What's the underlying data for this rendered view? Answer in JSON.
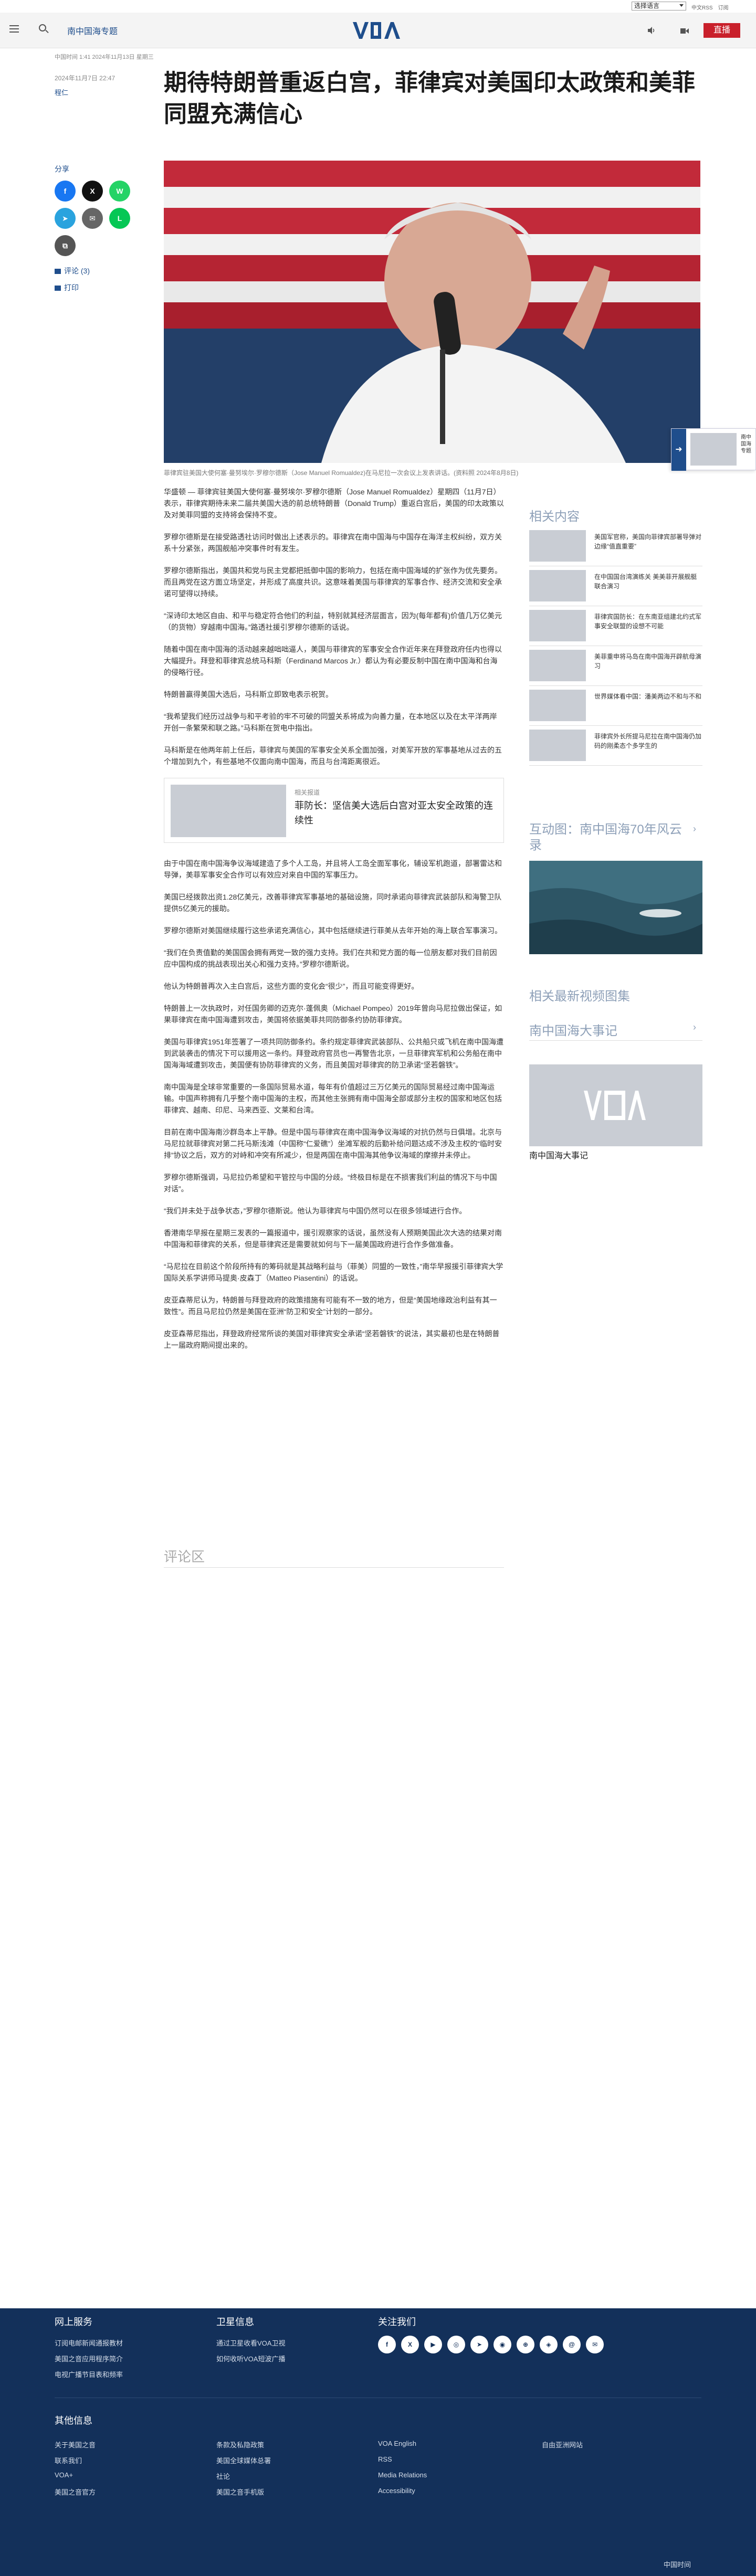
{
  "topbar": {
    "language": "选择语言",
    "links": [
      "中文RSS",
      "订阅"
    ]
  },
  "header": {
    "section": "南中国海专题",
    "logo": "VOA",
    "live": "直播"
  },
  "byline": {
    "date_line": "中国时间 1:41 2024年11月13日 星期三",
    "date": "2024年11月7日 22:47",
    "author": "程仁"
  },
  "headline": "期待特朗普重返白宫，菲律宾对美国印太政策和美菲同盟充满信心",
  "share": {
    "label": "分享",
    "buttons": [
      {
        "icon": "facebook-icon",
        "glyph": "f",
        "color": "#1877f2"
      },
      {
        "icon": "x-icon",
        "glyph": "X",
        "color": "#111111"
      },
      {
        "icon": "whatsapp-icon",
        "glyph": "W",
        "color": "#25d366"
      },
      {
        "icon": "telegram-icon",
        "glyph": "➤",
        "color": "#2aa3de"
      },
      {
        "icon": "email-icon",
        "glyph": "✉",
        "color": "#666666"
      },
      {
        "icon": "line-icon",
        "glyph": "L",
        "color": "#06c755"
      },
      {
        "icon": "copy-link-icon",
        "glyph": "⧉",
        "color": "#555555"
      }
    ],
    "comment": "评论 (3)",
    "print": "打印"
  },
  "hero": {
    "caption": "菲律宾驻美国大使何塞·曼努埃尔·罗穆尔德斯（Jose Manuel Romualdez)在马尼拉一次会议上发表讲话。(资料照 2024年8月8日)"
  },
  "float_tab": {
    "text": "南中国海专题"
  },
  "article": {
    "paragraphs": [
      "华盛顿 — 菲律宾驻美国大使何塞·曼努埃尔·罗穆尔德斯（Jose Manuel Romualdez）星期四（11月7日）表示，菲律宾期待未来二届共美国大选的前总统特朗普（Donald Trump）重返白宫后，美国的印太政策以及对美菲同盟的支持将会保持不变。",
      "罗穆尔德斯是在接受路透社访问时做出上述表示的。菲律宾在南中国海与中国存在海洋主权纠纷，双方关系十分紧张，两国舰船冲突事件时有发生。",
      "罗穆尔德斯指出，美国共和党与民主党都把抵御中国的影响力，包括在南中国海域的扩张作为优先要务。而且两党在这方面立场坚定，并形成了高度共识。这意味着美国与菲律宾的军事合作、经济交流和安全承诺可望得以持续。",
      "“深诗印太地区自由、和平与稳定符合他们的利益，特别就其经济层面言，因为(每年都有)价值几万亿美元（的货物）穿越南中国海。”路透社援引罗穆尔德斯的话说。",
      "随着中国在南中国海的活动越来越咄咄逼人，美国与菲律宾的军事安全合作近年来在拜登政府任内也得以大幅提升。拜登和菲律宾总统马科斯（Ferdinand Marcos Jr.）都认为有必要反制中国在南中国海和台海的侵略行径。",
      "特朗普赢得美国大选后，马科斯立即致电表示祝贺。",
      "“我希望我们经历过战争与和平考验的牢不可破的同盟关系将成为向善力量，在本地区以及在太平洋两岸开创一条繁荣和联之路。”马科斯在贺电中指出。",
      "马科斯是在他两年前上任后，菲律宾与美国的军事安全关系全面加强，对美军开放的军事基地从过去的五个增加到九个，有些基地不仅面向南中国海，而且与台湾距离很近。",
      "由于中国在南中国海争议海域建造了多个人工岛，并且将人工岛全面军事化，辅设军机跑道，部署雷达和导弹，美菲军事安全合作可以有效应对来自中国的军事压力。",
      "美国已经拨款出资1.28亿美元，改善菲律宾军事基地的基础设施，同时承诺向菲律宾武装部队和海警卫队提供5亿美元的援助。",
      "罗穆尔德斯对美国继续履行这些承诺充满信心，其中包括继续进行菲美从去年开始的海上联合军事演习。",
      "“我们在负责值勤的美国国会拥有两党一致的强力支持。我们在共和党方面的每一位朋友都对我们目前因应中国构成的挑战表现出关心和强力支持。”罗穆尔德斯说。",
      "他认为特朗普再次入主白宫后，这些方面的变化会“很少”，而且可能变得更好。",
      "特朗普上一次执政时，对任国务卿的迈克尔·蓬佩奥（Michael Pompeo）2019年曾向马尼拉做出保证，如果菲律宾在南中国海遭到攻击，美国将依据美菲共同防御条约协防菲律宾。",
      "美国与菲律宾1951年签署了一项共同防御条约。条约规定菲律宾武装部队、公共船只或飞机在南中国海遭到武装袭击的情况下可以援用这一条约。拜登政府官员也一再警告北京，一旦菲律宾军机和公务船在南中国海海域遭到攻击，美国便有协防菲律宾的义务，而且美国对菲律宾的防卫承诺“坚若磐铁”。",
      "南中国海是全球非常重要的一条国际贸易水道，每年有价值超过三万亿美元的国际贸易经过南中国海运输。中国声称拥有几乎整个南中国海的主权，而其他主张拥有南中国海全部或部分主权的国家和地区包括菲律宾、越南、印尼、马来西亚、文莱和台湾。",
      "目前在南中国海南沙群岛本上平静。但是中国与菲律宾在南中国海争议海域的对抗仍然与日俱增。北京与马尼拉就菲律宾对第二托马斯浅滩（中国称“仁爱礁”）坐滩军舰的后勤补给问题达成不涉及主权的“临时安排”协议之后，双方的对峙和冲突有所减少，但是两国在南中国海其他争议海域的摩擦并未停止。",
      "罗穆尔德斯强调，马尼拉仍希望和平管控与中国的分歧。“终极目标是在不损害我们利益的情况下与中国对话”。",
      "“我们并未处于战争状态，”罗穆尔德斯说。他认为菲律宾与中国仍然可以在很多领域进行合作。",
      "香港南华早报在星期三发表的一篇报道中，援引观察家的话说，虽然没有人预期美国此次大选的结果对南中国海和菲律宾的关系，但是菲律宾还是需要就如何与下一届美国政府进行合作多做准备。",
      "“马尼拉在目前这个阶段所持有的筹码就是其战略利益与（菲美）同盟的一致性，”南华早报援引菲律宾大学国际关系学讲师马提奥·皮森丁（Matteo Piasentini）的话说。",
      "皮亚森蒂尼认为，特朗普与拜登政府的政策措施有可能有不一致的地方，但是“美国地缘政治利益有其一致性”。而且马尼拉仍然是美国在亚洲“防卫和安全”计划的一部分。",
      "皮亚森蒂尼指出，拜登政府经常所谈的美国对菲律宾安全承诺“坚若磐铁”的说法，其实最初也是在特朗普上一届政府期间提出来的。"
    ],
    "related": {
      "sub": "相关报道",
      "title": "菲防长：坚信美大选后白宫对亚太安全政策的连续性"
    },
    "comments": "评论区"
  },
  "sidebar": {
    "related_head": "相关内容",
    "related_items": [
      "美国军官称，美国向菲律宾部署导弹对边缘“值直重要”",
      "在中国国台湾演练关 美美菲开展舰艇联合演习",
      "菲律宾国防长：在东南亚组建北约式军事安全联盟的设想不可能",
      "美菲重申将马岛在南中国海开辟航母演习",
      "世界媒体看中国：潘美两边不和与不和",
      "菲律宾外长所提马尼拉在南中国海仍加码的刚柔态个多学生的"
    ],
    "video_head": "互动图：南中国海70年风云录",
    "recent_video_head": "相关最新视频图集",
    "events_head": "南中国海大事记",
    "events_caption": "南中国海大事记"
  },
  "footer": {
    "sections": [
      {
        "title": "网上服务",
        "links": [
          "订阅电邮新闻通报教材",
          "美国之音应用程序简介",
          "电视广播节目表和频率"
        ]
      },
      {
        "title": "卫星信息",
        "links": [
          "通过卫星收看VOA卫视",
          "如何收听VOA短波广播"
        ]
      },
      {
        "title": "关注我们",
        "links": []
      }
    ],
    "social": [
      "f",
      "X",
      "▶",
      "◎",
      "➤",
      "◉",
      "⊕",
      "◈",
      "@",
      "✉"
    ],
    "other_head": "其他信息",
    "other_links": [
      [
        "关于美国之音",
        "联系我们",
        "VOA+",
        "美国之音官方"
      ],
      [
        "条款及私隐政策",
        "美国全球媒体总署",
        "社论",
        "美国之音手机版"
      ],
      [
        "VOA English",
        "RSS",
        "Media Relations",
        "Accessibility"
      ],
      [
        "自由亚洲网站"
      ]
    ],
    "copyright": "中国时间"
  },
  "colors": {
    "brand": "#1f4e8c",
    "live": "#c9202b",
    "footer": "#13305a"
  }
}
